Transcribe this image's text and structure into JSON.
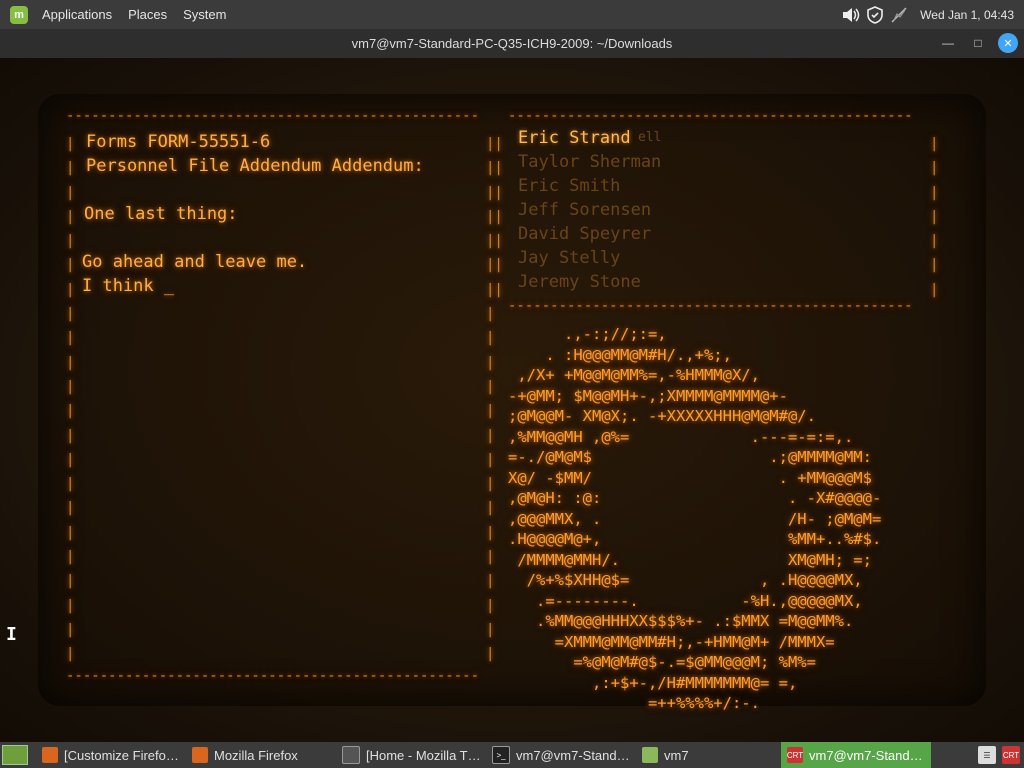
{
  "top_panel": {
    "menu": [
      "Applications",
      "Places",
      "System"
    ],
    "clock": "Wed Jan  1, 04:43",
    "icons": [
      "mint-logo-icon",
      "volume-icon",
      "shield-icon",
      "network-icon"
    ]
  },
  "window": {
    "title": "vm7@vm7-Standard-PC-Q35-ICH9-2009: ~/Downloads"
  },
  "terminal": {
    "left_panel": {
      "title": "Forms FORM-55551-6",
      "subtitle": "Personnel File Addendum Addendum:",
      "line1": "One last thing:",
      "line2": "Go ahead and leave me.",
      "line3": "I think _"
    },
    "name_list": {
      "active": "Eric Strand",
      "ghost": "ell",
      "names": [
        "Taylor Sherman",
        "Eric Smith",
        "Jeff Sorensen",
        "David Speyrer",
        "Jay Stelly",
        "Jeremy Stone"
      ]
    },
    "ascii_art": [
      "      .,-:;//;:=,",
      "    . :H@@@MM@M#H/.,+%;,",
      " ,/X+ +M@@M@MM%=,-%HMMM@X/,",
      "-+@MM; $M@@MH+-,;XMMMM@MMMM@+-",
      ";@M@@M- XM@X;. -+XXXXXHHH@M@M#@/.",
      ",%MM@@MH ,@%=             .---=-=:=,.",
      "=-./@M@M$                   .;@MMMM@MM:",
      "X@/ -$MM/                    . +MM@@@M$",
      ",@M@H: :@:                    . -X#@@@@-",
      ",@@@MMX, .                    /H- ;@M@M=",
      ".H@@@@M@+,                    %MM+..%#$.",
      " /MMMM@MMH/.                  XM@MH; =;",
      "  /%+%$XHH@$=              , .H@@@@MX,",
      "   .=--------.           -%H.,@@@@@MX,",
      "   .%MM@@@HHHXX$$$%+- .:$MMX =M@@MM%.",
      "     =XMMM@MM@MM#H;,-+HMM@M+ /MMMX=",
      "       =%@M@M#@$-.=$@MM@@@M; %M%=",
      "         ,:+$+-,/H#MMMMMMM@= =,",
      "               =++%%%%+/:-."
    ]
  },
  "taskbar": {
    "items": [
      {
        "label": "[Customize Firefo…",
        "icon": "firefox-icon",
        "active": false
      },
      {
        "label": "Mozilla Firefox",
        "icon": "firefox-icon",
        "active": false
      },
      {
        "label": "[Home - Mozilla T…",
        "icon": "thunderbird-icon",
        "active": false
      },
      {
        "label": "vm7@vm7-Stand…",
        "icon": "terminal-icon",
        "active": false
      },
      {
        "label": "vm7",
        "icon": "folder-icon",
        "active": false
      },
      {
        "label": "vm7@vm7-Stand…",
        "icon": "cool-retro-term-icon",
        "active": true
      }
    ]
  }
}
